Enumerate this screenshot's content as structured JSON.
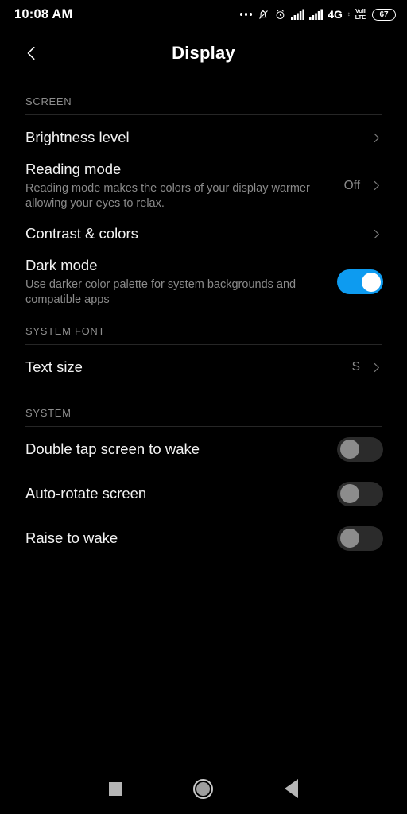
{
  "status_bar": {
    "time": "10:08 AM",
    "icons": [
      "more-dots-icon",
      "bell-muted-icon",
      "alarm-clock-icon",
      "signal-bars-icon",
      "signal-bars-icon"
    ],
    "network_type": "4G",
    "data_arrow": "↕",
    "volte_line1": "VoII",
    "volte_line2": "LTE",
    "battery_percent": "67"
  },
  "header": {
    "back_icon": "chevron-left-icon",
    "title": "Display"
  },
  "sections": [
    {
      "label": "SCREEN",
      "rows": [
        {
          "title": "Brightness level",
          "sub": "",
          "value": "",
          "control": "chevron"
        },
        {
          "title": "Reading mode",
          "sub": "Reading mode makes the colors of your display warmer allowing your eyes to relax.",
          "value": "Off",
          "control": "chevron"
        },
        {
          "title": "Contrast & colors",
          "sub": "",
          "value": "",
          "control": "chevron"
        },
        {
          "title": "Dark mode",
          "sub": "Use darker color palette for system backgrounds and compatible apps",
          "value": "",
          "control": "toggle-on"
        }
      ]
    },
    {
      "label": "SYSTEM FONT",
      "rows": [
        {
          "title": "Text size",
          "sub": "",
          "value": "S",
          "control": "chevron"
        }
      ]
    },
    {
      "label": "SYSTEM",
      "rows": [
        {
          "title": "Double tap screen to wake",
          "sub": "",
          "value": "",
          "control": "toggle-off"
        },
        {
          "title": "Auto-rotate screen",
          "sub": "",
          "value": "",
          "control": "toggle-off"
        },
        {
          "title": "Raise to wake",
          "sub": "",
          "value": "",
          "control": "toggle-off"
        }
      ]
    }
  ],
  "nav_bar": {
    "recents_icon": "square-recents-icon",
    "home_icon": "circle-home-icon",
    "back_icon": "triangle-back-icon"
  },
  "colors": {
    "background": "#000000",
    "toggle_on": "#0d9bf0",
    "toggle_off_track": "#2b2b2b",
    "toggle_off_knob": "#8c8c8c",
    "primary_text": "#f2f2f2",
    "secondary_text": "#8a8a8a"
  }
}
